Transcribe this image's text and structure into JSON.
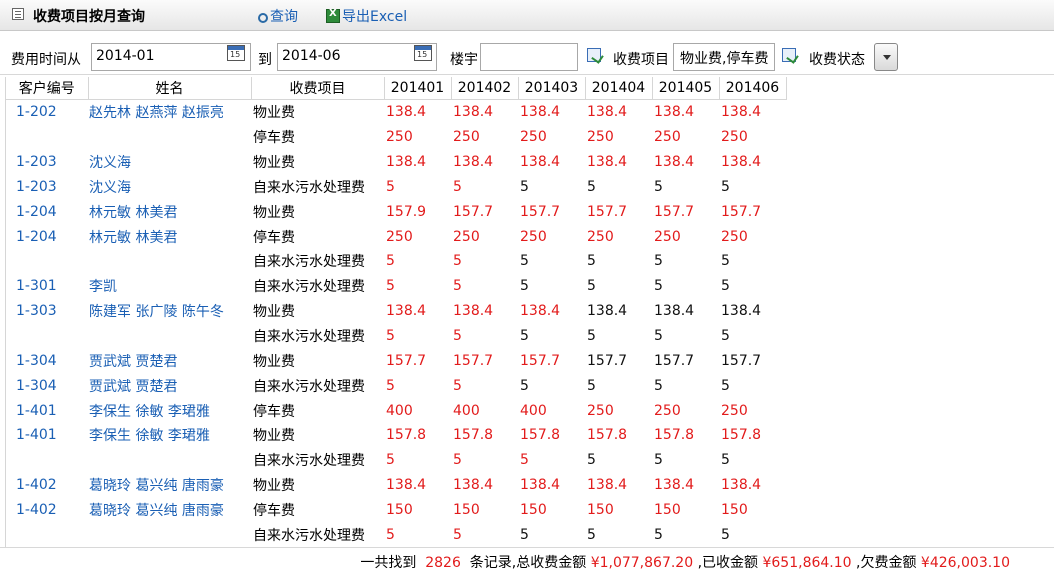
{
  "title": "收费项目按月查询",
  "toolbar": {
    "query_label": "查询",
    "export_label": "导出Excel"
  },
  "filters": {
    "date_from_label": "费用时间从",
    "date_from_value": "2014-01",
    "date_to_label": "到",
    "date_to_value": "2014-06",
    "calendar_day": "15",
    "building_label": "楼宇",
    "building_value": "",
    "item_label": "收费项目",
    "item_value": "物业费,停车费",
    "status_label": "收费状态"
  },
  "table": {
    "headers": [
      "客户编号",
      "姓名",
      "收费项目",
      "201401",
      "201402",
      "201403",
      "201404",
      "201405",
      "201406"
    ],
    "rows": [
      {
        "id": "1-202",
        "name": "赵先林  赵燕萍  赵振亮",
        "item": "物业费",
        "vals": [
          "138.4",
          "138.4",
          "138.4",
          "138.4",
          "138.4",
          "138.4"
        ],
        "paid": [
          false,
          false,
          false,
          false,
          false,
          false
        ]
      },
      {
        "id": "",
        "name": "",
        "item": "停车费",
        "vals": [
          "250",
          "250",
          "250",
          "250",
          "250",
          "250"
        ],
        "paid": [
          false,
          false,
          false,
          false,
          false,
          false
        ]
      },
      {
        "id": "1-203",
        "name": "沈义海",
        "item": "物业费",
        "vals": [
          "138.4",
          "138.4",
          "138.4",
          "138.4",
          "138.4",
          "138.4"
        ],
        "paid": [
          false,
          false,
          false,
          false,
          false,
          false
        ]
      },
      {
        "id": "1-203",
        "name": "沈义海",
        "item": "自来水污水处理费",
        "vals": [
          "5",
          "5",
          "5",
          "5",
          "5",
          "5"
        ],
        "paid": [
          false,
          false,
          true,
          true,
          true,
          true
        ]
      },
      {
        "id": "1-204",
        "name": "林元敏  林美君",
        "item": "物业费",
        "vals": [
          "157.9",
          "157.7",
          "157.7",
          "157.7",
          "157.7",
          "157.7"
        ],
        "paid": [
          false,
          false,
          false,
          false,
          false,
          false
        ]
      },
      {
        "id": "1-204",
        "name": "林元敏  林美君",
        "item": "停车费",
        "vals": [
          "250",
          "250",
          "250",
          "250",
          "250",
          "250"
        ],
        "paid": [
          false,
          false,
          false,
          false,
          false,
          false
        ]
      },
      {
        "id": "",
        "name": "",
        "item": "自来水污水处理费",
        "vals": [
          "5",
          "5",
          "5",
          "5",
          "5",
          "5"
        ],
        "paid": [
          false,
          false,
          true,
          true,
          true,
          true
        ]
      },
      {
        "id": "1-301",
        "name": "李凯",
        "item": "自来水污水处理费",
        "vals": [
          "5",
          "5",
          "5",
          "5",
          "5",
          "5"
        ],
        "paid": [
          false,
          false,
          true,
          true,
          true,
          true
        ]
      },
      {
        "id": "1-303",
        "name": "陈建军  张广陵  陈午冬",
        "item": "物业费",
        "vals": [
          "138.4",
          "138.4",
          "138.4",
          "138.4",
          "138.4",
          "138.4"
        ],
        "paid": [
          false,
          false,
          false,
          true,
          true,
          true
        ]
      },
      {
        "id": "",
        "name": "",
        "item": "自来水污水处理费",
        "vals": [
          "5",
          "5",
          "5",
          "5",
          "5",
          "5"
        ],
        "paid": [
          false,
          false,
          true,
          true,
          true,
          true
        ]
      },
      {
        "id": "1-304",
        "name": "贾武斌  贾楚君",
        "item": "物业费",
        "vals": [
          "157.7",
          "157.7",
          "157.7",
          "157.7",
          "157.7",
          "157.7"
        ],
        "paid": [
          false,
          false,
          false,
          true,
          true,
          true
        ]
      },
      {
        "id": "1-304",
        "name": "贾武斌  贾楚君",
        "item": "自来水污水处理费",
        "vals": [
          "5",
          "5",
          "5",
          "5",
          "5",
          "5"
        ],
        "paid": [
          false,
          false,
          true,
          true,
          true,
          true
        ]
      },
      {
        "id": "1-401",
        "name": "李保生  徐敏   李珺雅",
        "item": "停车费",
        "vals": [
          "400",
          "400",
          "400",
          "250",
          "250",
          "250"
        ],
        "paid": [
          false,
          false,
          false,
          false,
          false,
          false
        ]
      },
      {
        "id": "1-401",
        "name": "李保生  徐敏   李珺雅",
        "item": "物业费",
        "vals": [
          "157.8",
          "157.8",
          "157.8",
          "157.8",
          "157.8",
          "157.8"
        ],
        "paid": [
          false,
          false,
          false,
          false,
          false,
          false
        ]
      },
      {
        "id": "",
        "name": "",
        "item": "自来水污水处理费",
        "vals": [
          "5",
          "5",
          "5",
          "5",
          "5",
          "5"
        ],
        "paid": [
          false,
          false,
          false,
          true,
          true,
          true
        ]
      },
      {
        "id": "1-402",
        "name": "葛晓玲  葛兴纯  唐雨豪",
        "item": "物业费",
        "vals": [
          "138.4",
          "138.4",
          "138.4",
          "138.4",
          "138.4",
          "138.4"
        ],
        "paid": [
          false,
          false,
          false,
          false,
          false,
          false
        ]
      },
      {
        "id": "1-402",
        "name": "葛晓玲  葛兴纯  唐雨豪",
        "item": "停车费",
        "vals": [
          "150",
          "150",
          "150",
          "150",
          "150",
          "150"
        ],
        "paid": [
          false,
          false,
          false,
          false,
          false,
          false
        ]
      },
      {
        "id": "",
        "name": "",
        "item": "自来水污水处理费",
        "vals": [
          "5",
          "5",
          "5",
          "5",
          "5",
          "5"
        ],
        "paid": [
          false,
          false,
          true,
          true,
          true,
          true
        ]
      }
    ]
  },
  "colors": {
    "unpaid": "#e21b1b",
    "paid": "#111111",
    "link": "#1a5fb4"
  },
  "footer": {
    "prefix": "一共找到",
    "count": "2826",
    "mid1": "条记录,总收费金额",
    "total": "¥1,077,867.20",
    "mid2": ",已收金额",
    "paid": "¥651,864.10",
    "mid3": ",欠费金额",
    "owed": "¥426,003.10"
  }
}
